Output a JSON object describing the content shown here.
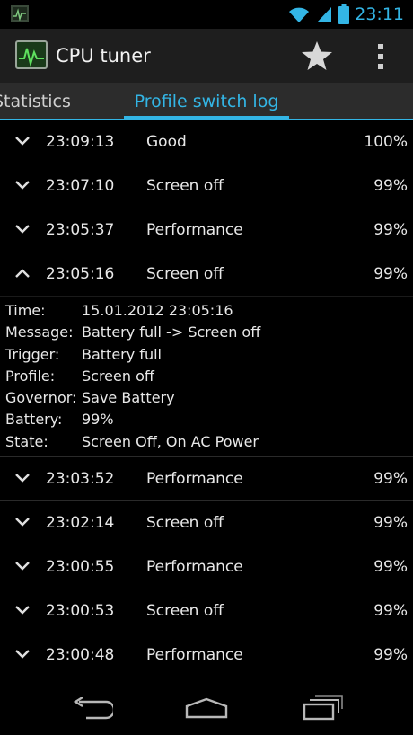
{
  "status_bar": {
    "time": "23:11"
  },
  "action_bar": {
    "title": "CPU tuner"
  },
  "tabs": [
    {
      "label": "Statistics"
    },
    {
      "label": "Profile switch log"
    }
  ],
  "log": [
    {
      "time": "23:09:13",
      "profile": "Good",
      "battery": "100%",
      "expanded": false
    },
    {
      "time": "23:07:10",
      "profile": "Screen off",
      "battery": "99%",
      "expanded": false
    },
    {
      "time": "23:05:37",
      "profile": "Performance",
      "battery": "99%",
      "expanded": false
    },
    {
      "time": "23:05:16",
      "profile": "Screen off",
      "battery": "99%",
      "expanded": true
    },
    {
      "time": "23:03:52",
      "profile": "Performance",
      "battery": "99%",
      "expanded": false
    },
    {
      "time": "23:02:14",
      "profile": "Screen off",
      "battery": "99%",
      "expanded": false
    },
    {
      "time": "23:00:55",
      "profile": "Performance",
      "battery": "99%",
      "expanded": false
    },
    {
      "time": "23:00:53",
      "profile": "Screen off",
      "battery": "99%",
      "expanded": false
    },
    {
      "time": "23:00:48",
      "profile": "Performance",
      "battery": "99%",
      "expanded": false
    }
  ],
  "details": [
    {
      "label": "Time:",
      "value": "15.01.2012 23:05:16"
    },
    {
      "label": "Message:",
      "value": "Battery full -> Screen off"
    },
    {
      "label": "Trigger:",
      "value": "Battery full"
    },
    {
      "label": "Profile:",
      "value": "Screen off"
    },
    {
      "label": "Governor:",
      "value": "Save Battery"
    },
    {
      "label": "Battery:",
      "value": "99%"
    },
    {
      "label": "State:",
      "value": "Screen Off, On AC Power"
    }
  ],
  "colors": {
    "accent": "#33b5e5",
    "action_bar": "#1e1e1e",
    "tab_bar": "#2c2c2c"
  }
}
